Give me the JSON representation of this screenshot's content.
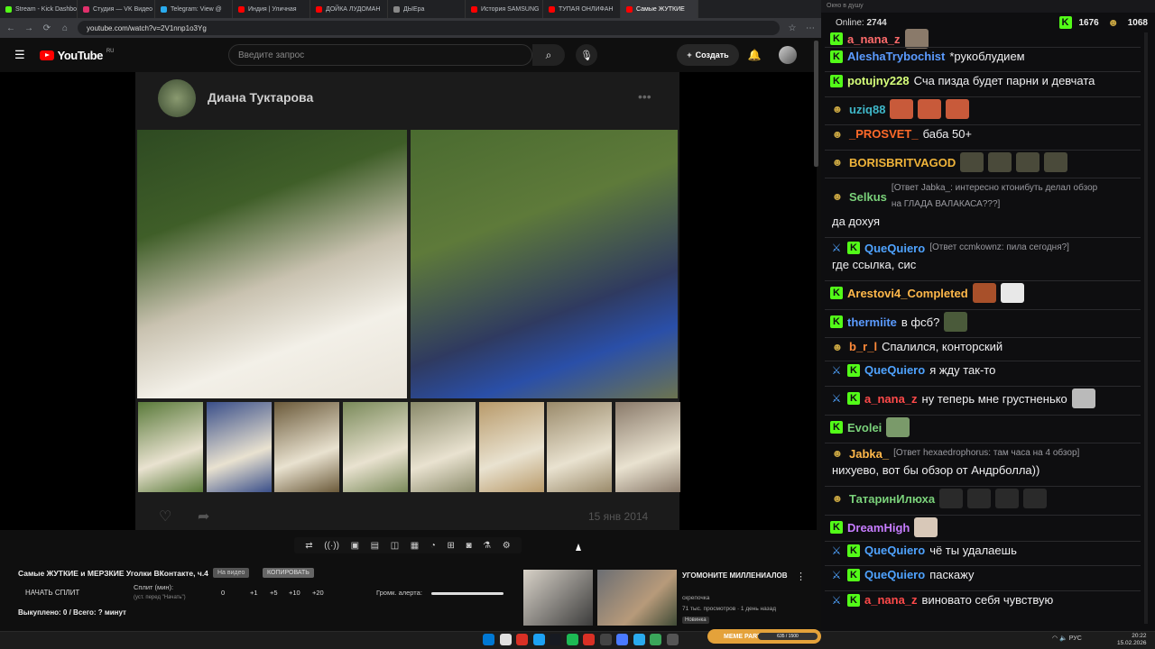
{
  "browser": {
    "tabs": [
      {
        "title": "Stream - Kick Dashboard",
        "color": "#53fc18",
        "active": false
      },
      {
        "title": "Студия — VK Видео",
        "color": "#e1306c",
        "active": false
      },
      {
        "title": "Telegram: View @",
        "color": "#2aabee",
        "active": false
      },
      {
        "title": "Индия | Уличная",
        "color": "#ff0000",
        "active": false
      },
      {
        "title": "ДОЙКА ЛУДОМАН",
        "color": "#ff0000",
        "active": false
      },
      {
        "title": "ДЫЕра",
        "color": "#888888",
        "active": false
      },
      {
        "title": "История SAMSUNG",
        "color": "#ff0000",
        "active": false
      },
      {
        "title": "ТУПАЯ ОНЛИФАН",
        "color": "#ff0000",
        "active": false
      },
      {
        "title": "Самые ЖУТКИЕ",
        "color": "#ff0000",
        "active": true
      }
    ],
    "url": "youtube.com/watch?v=2V1nnp1o3Yg"
  },
  "youtube": {
    "logo_text": "YouTube",
    "region": "RU",
    "search_placeholder": "Введите запрос",
    "create_label": "Создать"
  },
  "post": {
    "author": "Диана Туктарова",
    "date": "15 янв 2014",
    "thumb_colors": [
      "#5a7a3a",
      "#3a4f8a",
      "#6b5a3a",
      "#7a8a5a",
      "#8a8a6a",
      "#b89a6a",
      "#9a8a6a",
      "#8a7a6a"
    ]
  },
  "panel": {
    "title": "Самые ЖУТКИЕ и МЕРЗКИЕ Уголки ВКонтакте, ч.4",
    "on_video_label": "На видео",
    "copy_label": "КОПИРОВАТЬ",
    "start_split": "НАЧАТЬ СПЛИТ",
    "split_label": "Сплит (мин):",
    "split_hint": "(уст. перед \"Начать\")",
    "split_value": "0",
    "increments": [
      "+1",
      "+5",
      "+10",
      "+20"
    ],
    "alert_label": "Громк. алерта:",
    "bought": "Выкуплено: 0 / Всего: ? минут"
  },
  "recommended": {
    "title": "УГОМОНИТЕ МИЛЛЕНИАЛОВ",
    "channel": "скрепочка",
    "stats": "71 тыс. просмотров · 1 день назад",
    "badge": "Новинка"
  },
  "chat": {
    "window_title": "Окно в душу",
    "online_label": "Online:",
    "online_value": "2744",
    "kick_count": "1676",
    "pepe_count": "1068",
    "messages": [
      {
        "badge": "kick",
        "user": "a_nana_z",
        "color": "#ff6b6b",
        "text": "",
        "reply": "",
        "emotes": [
          "#8a7a6a"
        ]
      },
      {
        "badge": "kick",
        "user": "AleshaTrybochist",
        "color": "#5b9bff",
        "text": "*рукоблудием",
        "reply": "",
        "emotes": []
      },
      {
        "badge": "kick",
        "user": "potujny228",
        "color": "#d6ff7a",
        "text": "Сча пизда будет парни и девчата",
        "reply": "",
        "emotes": []
      },
      {
        "badge": "pepe",
        "user": "uziq88",
        "color": "#3fb7c9",
        "text": "",
        "reply": "",
        "emotes": [
          "#c85a3a",
          "#c85a3a",
          "#c85a3a"
        ]
      },
      {
        "badge": "pepe",
        "user": "_PROSVET_",
        "color": "#ff6a2a",
        "text": "баба 50+",
        "reply": "",
        "emotes": []
      },
      {
        "badge": "pepe",
        "user": "BORISBRITVAGOD",
        "color": "#f0b43a",
        "text": "",
        "reply": "",
        "emotes": [
          "#4a4a3a",
          "#4a4a3a",
          "#4a4a3a",
          "#4a4a3a"
        ]
      },
      {
        "badge": "pepe",
        "user": "Selkus",
        "color": "#7ad17a",
        "text": "да дохуя",
        "reply": "[Ответ Jabka_: интересно ктонибуть делал обзор на ГЛАДА ВАЛАКАСА???]",
        "emotes": []
      },
      {
        "badge": "sword",
        "user": "QueQuiero",
        "color": "#4fa3ff",
        "text": "где ссылка, сис",
        "reply": "[Ответ ccmkownz: пила сегодня?]",
        "emotes": []
      },
      {
        "badge": "kick",
        "user": "Arestovi4_Completed",
        "color": "#ffb84a",
        "text": "",
        "reply": "",
        "emotes": [
          "#a8502a",
          "#e8e8e8"
        ]
      },
      {
        "badge": "kick",
        "user": "thermiite",
        "color": "#5b9bff",
        "text": "в фсб?",
        "reply": "",
        "emotes": [
          "#4a5a3a"
        ]
      },
      {
        "badge": "pepe",
        "user": "b_r_l",
        "color": "#ff8a3a",
        "text": "Спалился, конторский",
        "reply": "",
        "emotes": []
      },
      {
        "badge": "sword",
        "user": "QueQuiero",
        "color": "#4fa3ff",
        "text": "я жду так-то",
        "reply": "",
        "emotes": []
      },
      {
        "badge": "sword",
        "user": "a_nana_z",
        "color": "#ff4a4a",
        "text": "ну теперь мне грустненько",
        "reply": "",
        "emotes": [
          "#bababa"
        ]
      },
      {
        "badge": "kick",
        "user": "Evolei",
        "color": "#7ad17a",
        "text": "",
        "reply": "",
        "emotes": [
          "#7a9a6a"
        ]
      },
      {
        "badge": "pepe",
        "user": "Jabka_",
        "color": "#ffb84a",
        "text": "нихуево, вот бы обзор от Андрболла))",
        "reply": "[Ответ hexaedrophorus: там часа на 4 обзор]",
        "emotes": []
      },
      {
        "badge": "pepe",
        "user": "ТатаринИлюха",
        "color": "#7ad17a",
        "text": "",
        "reply": "",
        "emotes": [
          "#2a2a2a",
          "#2a2a2a",
          "#2a2a2a",
          "#2a2a2a"
        ]
      },
      {
        "badge": "kick",
        "user": "DreamHigh",
        "color": "#c77dff",
        "text": "",
        "reply": "",
        "emotes": [
          "#d8c8b8"
        ]
      },
      {
        "badge": "sword",
        "user": "QueQuiero",
        "color": "#4fa3ff",
        "text": "чё ты удалаешь",
        "reply": "",
        "emotes": []
      },
      {
        "badge": "sword",
        "user": "QueQuiero",
        "color": "#4fa3ff",
        "text": "паскажу",
        "reply": "",
        "emotes": []
      },
      {
        "badge": "sword",
        "user": "a_nana_z",
        "color": "#ff4a4a",
        "text": "виновато себя чувствую",
        "reply": "",
        "emotes": []
      }
    ]
  },
  "taskbar": {
    "meme_label": "MEME PARTY",
    "meme_progress": "635 / 1500",
    "lang": "РУС",
    "time": "20:22",
    "date": "15.02.2026"
  }
}
